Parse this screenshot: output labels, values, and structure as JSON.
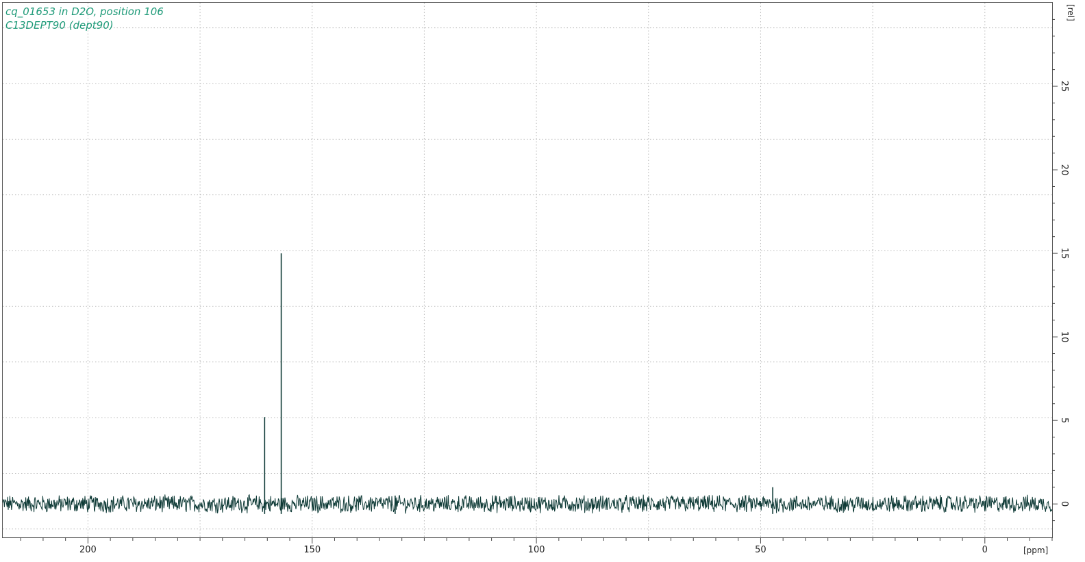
{
  "title": {
    "line1": "cq_01653 in D2O, position 106",
    "line2": "C13DEPT90 (dept90)"
  },
  "colors": {
    "title": "#1e9a78",
    "spectrum": "#0e3a36",
    "grid": "#b8b8b8",
    "frame": "#555555"
  },
  "chart_data": {
    "type": "line",
    "xlabel": "[ppm]",
    "ylabel": "[rel]",
    "xlim": [
      219,
      -15
    ],
    "ylim": [
      -2,
      30
    ],
    "x_ticks": [
      200,
      150,
      100,
      50,
      0
    ],
    "y_ticks": [
      0,
      5,
      10,
      15,
      20,
      25
    ],
    "x_ticklabels": [
      "200",
      "150",
      "100",
      "50",
      "0"
    ],
    "y_ticklabels": [
      "0",
      "5",
      "10",
      "15",
      "20",
      "25"
    ],
    "grid": true,
    "baseline_noise_amplitude": 0.45,
    "series": [
      {
        "peaks": [
          {
            "ppm": 160.6,
            "intensity": 5.2
          },
          {
            "ppm": 156.9,
            "intensity": 15.0
          },
          {
            "ppm": 131.5,
            "intensity": 0.5
          },
          {
            "ppm": 47.3,
            "intensity": 1.0
          }
        ]
      }
    ]
  }
}
